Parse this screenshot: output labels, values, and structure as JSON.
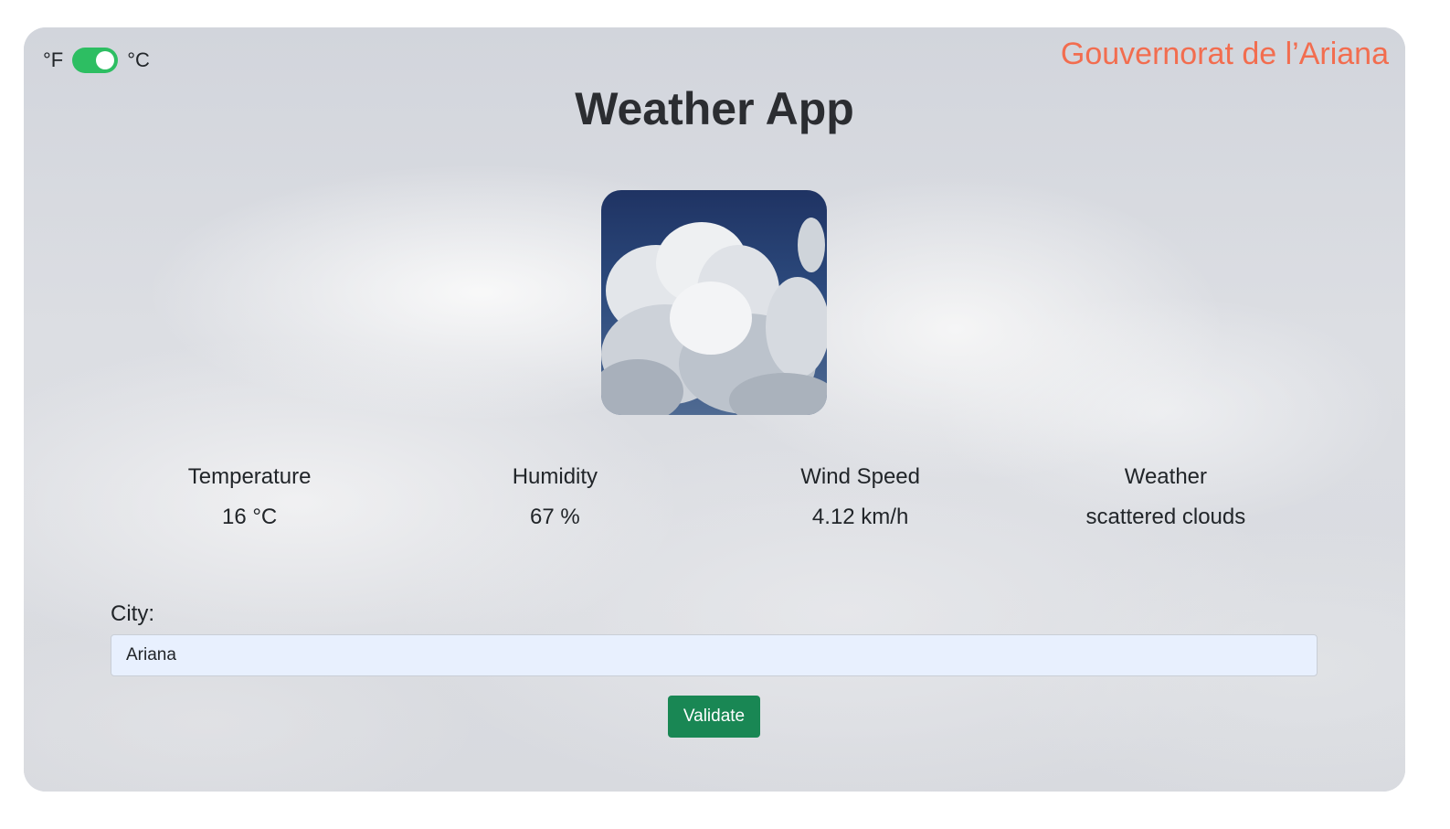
{
  "units": {
    "fahrenheit_label": "°F",
    "celsius_label": "°C",
    "celsius_selected": true
  },
  "location": {
    "region_name": "Gouvernorat de l’Ariana"
  },
  "app": {
    "title": "Weather App"
  },
  "stats": [
    {
      "label": "Temperature",
      "value": "16 °C"
    },
    {
      "label": "Humidity",
      "value": "67 %"
    },
    {
      "label": "Wind Speed",
      "value": "4.12 km/h"
    },
    {
      "label": "Weather",
      "value": "scattered clouds"
    }
  ],
  "form": {
    "city_label": "City:",
    "city_value": "Ariana",
    "submit_label": "Validate"
  },
  "colors": {
    "toggle_on": "#2dbe62",
    "region_text": "#f26d4f",
    "button_bg": "#198754",
    "input_bg": "#e8f0fe"
  }
}
